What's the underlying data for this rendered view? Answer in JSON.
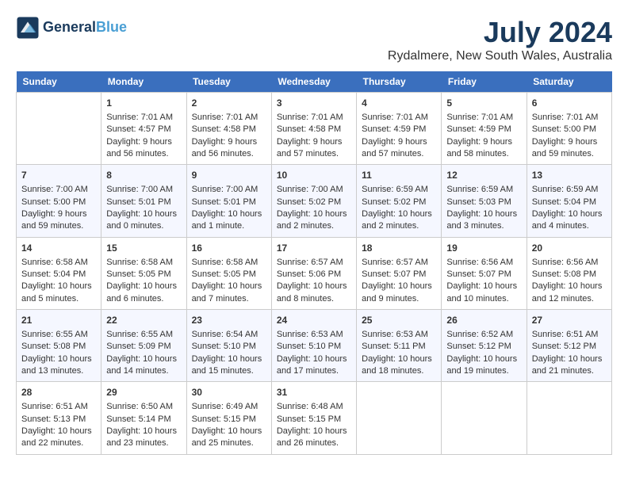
{
  "header": {
    "logo_line1": "General",
    "logo_line2": "Blue",
    "month": "July 2024",
    "location": "Rydalmere, New South Wales, Australia"
  },
  "weekdays": [
    "Sunday",
    "Monday",
    "Tuesday",
    "Wednesday",
    "Thursday",
    "Friday",
    "Saturday"
  ],
  "weeks": [
    [
      {
        "day": "",
        "info": ""
      },
      {
        "day": "1",
        "info": "Sunrise: 7:01 AM\nSunset: 4:57 PM\nDaylight: 9 hours\nand 56 minutes."
      },
      {
        "day": "2",
        "info": "Sunrise: 7:01 AM\nSunset: 4:58 PM\nDaylight: 9 hours\nand 56 minutes."
      },
      {
        "day": "3",
        "info": "Sunrise: 7:01 AM\nSunset: 4:58 PM\nDaylight: 9 hours\nand 57 minutes."
      },
      {
        "day": "4",
        "info": "Sunrise: 7:01 AM\nSunset: 4:59 PM\nDaylight: 9 hours\nand 57 minutes."
      },
      {
        "day": "5",
        "info": "Sunrise: 7:01 AM\nSunset: 4:59 PM\nDaylight: 9 hours\nand 58 minutes."
      },
      {
        "day": "6",
        "info": "Sunrise: 7:01 AM\nSunset: 5:00 PM\nDaylight: 9 hours\nand 59 minutes."
      }
    ],
    [
      {
        "day": "7",
        "info": "Sunrise: 7:00 AM\nSunset: 5:00 PM\nDaylight: 9 hours\nand 59 minutes."
      },
      {
        "day": "8",
        "info": "Sunrise: 7:00 AM\nSunset: 5:01 PM\nDaylight: 10 hours\nand 0 minutes."
      },
      {
        "day": "9",
        "info": "Sunrise: 7:00 AM\nSunset: 5:01 PM\nDaylight: 10 hours\nand 1 minute."
      },
      {
        "day": "10",
        "info": "Sunrise: 7:00 AM\nSunset: 5:02 PM\nDaylight: 10 hours\nand 2 minutes."
      },
      {
        "day": "11",
        "info": "Sunrise: 6:59 AM\nSunset: 5:02 PM\nDaylight: 10 hours\nand 2 minutes."
      },
      {
        "day": "12",
        "info": "Sunrise: 6:59 AM\nSunset: 5:03 PM\nDaylight: 10 hours\nand 3 minutes."
      },
      {
        "day": "13",
        "info": "Sunrise: 6:59 AM\nSunset: 5:04 PM\nDaylight: 10 hours\nand 4 minutes."
      }
    ],
    [
      {
        "day": "14",
        "info": "Sunrise: 6:58 AM\nSunset: 5:04 PM\nDaylight: 10 hours\nand 5 minutes."
      },
      {
        "day": "15",
        "info": "Sunrise: 6:58 AM\nSunset: 5:05 PM\nDaylight: 10 hours\nand 6 minutes."
      },
      {
        "day": "16",
        "info": "Sunrise: 6:58 AM\nSunset: 5:05 PM\nDaylight: 10 hours\nand 7 minutes."
      },
      {
        "day": "17",
        "info": "Sunrise: 6:57 AM\nSunset: 5:06 PM\nDaylight: 10 hours\nand 8 minutes."
      },
      {
        "day": "18",
        "info": "Sunrise: 6:57 AM\nSunset: 5:07 PM\nDaylight: 10 hours\nand 9 minutes."
      },
      {
        "day": "19",
        "info": "Sunrise: 6:56 AM\nSunset: 5:07 PM\nDaylight: 10 hours\nand 10 minutes."
      },
      {
        "day": "20",
        "info": "Sunrise: 6:56 AM\nSunset: 5:08 PM\nDaylight: 10 hours\nand 12 minutes."
      }
    ],
    [
      {
        "day": "21",
        "info": "Sunrise: 6:55 AM\nSunset: 5:08 PM\nDaylight: 10 hours\nand 13 minutes."
      },
      {
        "day": "22",
        "info": "Sunrise: 6:55 AM\nSunset: 5:09 PM\nDaylight: 10 hours\nand 14 minutes."
      },
      {
        "day": "23",
        "info": "Sunrise: 6:54 AM\nSunset: 5:10 PM\nDaylight: 10 hours\nand 15 minutes."
      },
      {
        "day": "24",
        "info": "Sunrise: 6:53 AM\nSunset: 5:10 PM\nDaylight: 10 hours\nand 17 minutes."
      },
      {
        "day": "25",
        "info": "Sunrise: 6:53 AM\nSunset: 5:11 PM\nDaylight: 10 hours\nand 18 minutes."
      },
      {
        "day": "26",
        "info": "Sunrise: 6:52 AM\nSunset: 5:12 PM\nDaylight: 10 hours\nand 19 minutes."
      },
      {
        "day": "27",
        "info": "Sunrise: 6:51 AM\nSunset: 5:12 PM\nDaylight: 10 hours\nand 21 minutes."
      }
    ],
    [
      {
        "day": "28",
        "info": "Sunrise: 6:51 AM\nSunset: 5:13 PM\nDaylight: 10 hours\nand 22 minutes."
      },
      {
        "day": "29",
        "info": "Sunrise: 6:50 AM\nSunset: 5:14 PM\nDaylight: 10 hours\nand 23 minutes."
      },
      {
        "day": "30",
        "info": "Sunrise: 6:49 AM\nSunset: 5:15 PM\nDaylight: 10 hours\nand 25 minutes."
      },
      {
        "day": "31",
        "info": "Sunrise: 6:48 AM\nSunset: 5:15 PM\nDaylight: 10 hours\nand 26 minutes."
      },
      {
        "day": "",
        "info": ""
      },
      {
        "day": "",
        "info": ""
      },
      {
        "day": "",
        "info": ""
      }
    ]
  ]
}
